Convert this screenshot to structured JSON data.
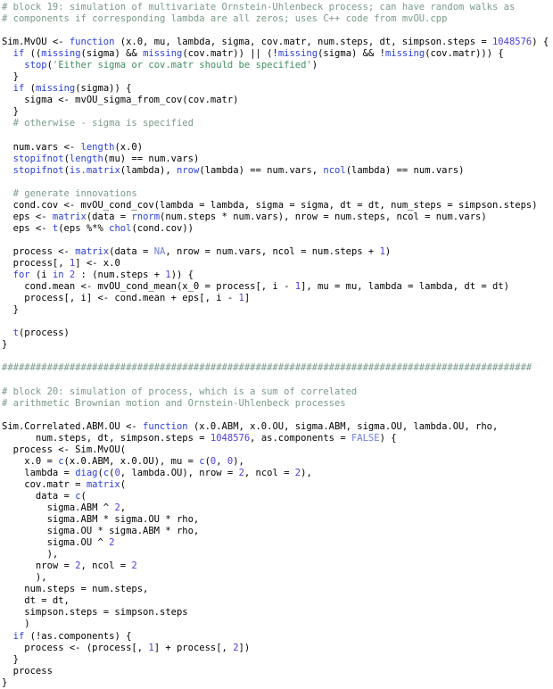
{
  "editor": {
    "language": "R",
    "background": "#ffffff",
    "foreground": "#000000",
    "colors": {
      "comment": "#7a9a8a",
      "keyword": "#2b3fd4",
      "function": "#2b3fd4",
      "number": "#4b3fd6",
      "string": "#3f8f5f",
      "constant": "#6f7fd8",
      "plain": "#000000"
    }
  },
  "code": {
    "lines": [
      [
        {
          "t": "# block 19: simulation of multivariate Ornstein-Uhlenbeck process; can have random walks as",
          "c": "cmt"
        }
      ],
      [
        {
          "t": "# components if corresponding lambda are all zeros; uses C++ code from mvOU.cpp",
          "c": "cmt"
        }
      ],
      [],
      [
        {
          "t": "Sim.MvOU <- ",
          "c": "pl"
        },
        {
          "t": "function",
          "c": "kw"
        },
        {
          "t": " (x.0, mu, lambda, sigma, cov.matr, num.steps, dt, simpson.steps = ",
          "c": "pl"
        },
        {
          "t": "1048576",
          "c": "num"
        },
        {
          "t": ") {",
          "c": "pl"
        }
      ],
      [
        {
          "t": "  ",
          "c": "pl"
        },
        {
          "t": "if",
          "c": "kw"
        },
        {
          "t": " ((",
          "c": "pl"
        },
        {
          "t": "missing",
          "c": "fn"
        },
        {
          "t": "(sigma) && ",
          "c": "pl"
        },
        {
          "t": "missing",
          "c": "fn"
        },
        {
          "t": "(cov.matr)) || (!",
          "c": "pl"
        },
        {
          "t": "missing",
          "c": "fn"
        },
        {
          "t": "(sigma) && !",
          "c": "pl"
        },
        {
          "t": "missing",
          "c": "fn"
        },
        {
          "t": "(cov.matr))) {",
          "c": "pl"
        }
      ],
      [
        {
          "t": "    ",
          "c": "pl"
        },
        {
          "t": "stop",
          "c": "fn"
        },
        {
          "t": "(",
          "c": "pl"
        },
        {
          "t": "'Either sigma or cov.matr should be specified'",
          "c": "str"
        },
        {
          "t": ")",
          "c": "pl"
        }
      ],
      [
        {
          "t": "  }",
          "c": "pl"
        }
      ],
      [
        {
          "t": "  ",
          "c": "pl"
        },
        {
          "t": "if",
          "c": "kw"
        },
        {
          "t": " (",
          "c": "pl"
        },
        {
          "t": "missing",
          "c": "fn"
        },
        {
          "t": "(sigma)) {",
          "c": "pl"
        }
      ],
      [
        {
          "t": "    sigma <- mvOU_sigma_from_cov(cov.matr)",
          "c": "pl"
        }
      ],
      [
        {
          "t": "  }",
          "c": "pl"
        }
      ],
      [
        {
          "t": "  # otherwise - sigma is specified",
          "c": "cmt"
        }
      ],
      [],
      [
        {
          "t": "  num.vars <- ",
          "c": "pl"
        },
        {
          "t": "length",
          "c": "fn"
        },
        {
          "t": "(x.0)",
          "c": "pl"
        }
      ],
      [
        {
          "t": "  ",
          "c": "pl"
        },
        {
          "t": "stopifnot",
          "c": "fn"
        },
        {
          "t": "(",
          "c": "pl"
        },
        {
          "t": "length",
          "c": "fn"
        },
        {
          "t": "(mu) == num.vars)",
          "c": "pl"
        }
      ],
      [
        {
          "t": "  ",
          "c": "pl"
        },
        {
          "t": "stopifnot",
          "c": "fn"
        },
        {
          "t": "(",
          "c": "pl"
        },
        {
          "t": "is.matrix",
          "c": "fn"
        },
        {
          "t": "(lambda), ",
          "c": "pl"
        },
        {
          "t": "nrow",
          "c": "fn"
        },
        {
          "t": "(lambda) == num.vars, ",
          "c": "pl"
        },
        {
          "t": "ncol",
          "c": "fn"
        },
        {
          "t": "(lambda) == num.vars)",
          "c": "pl"
        }
      ],
      [],
      [
        {
          "t": "  # generate innovations",
          "c": "cmt"
        }
      ],
      [
        {
          "t": "  cond.cov <- mvOU_cond_cov(lambda = lambda, sigma = sigma, dt = dt, num_steps = simpson.steps)",
          "c": "pl"
        }
      ],
      [
        {
          "t": "  eps <- ",
          "c": "pl"
        },
        {
          "t": "matrix",
          "c": "fn"
        },
        {
          "t": "(data = ",
          "c": "pl"
        },
        {
          "t": "rnorm",
          "c": "fn"
        },
        {
          "t": "(num.steps * num.vars), nrow = num.steps, ncol = num.vars)",
          "c": "pl"
        }
      ],
      [
        {
          "t": "  eps <- ",
          "c": "pl"
        },
        {
          "t": "t",
          "c": "fn"
        },
        {
          "t": "(eps ",
          "c": "pl"
        },
        {
          "t": "%*%",
          "c": "op"
        },
        {
          "t": " ",
          "c": "pl"
        },
        {
          "t": "chol",
          "c": "fn"
        },
        {
          "t": "(cond.cov))",
          "c": "pl"
        }
      ],
      [],
      [
        {
          "t": "  process <- ",
          "c": "pl"
        },
        {
          "t": "matrix",
          "c": "fn"
        },
        {
          "t": "(data = ",
          "c": "pl"
        },
        {
          "t": "NA",
          "c": "cst"
        },
        {
          "t": ", nrow = num.vars, ncol = num.steps + ",
          "c": "pl"
        },
        {
          "t": "1",
          "c": "num"
        },
        {
          "t": ")",
          "c": "pl"
        }
      ],
      [
        {
          "t": "  process[, ",
          "c": "pl"
        },
        {
          "t": "1",
          "c": "num"
        },
        {
          "t": "] <- x.0",
          "c": "pl"
        }
      ],
      [
        {
          "t": "  ",
          "c": "pl"
        },
        {
          "t": "for",
          "c": "kw"
        },
        {
          "t": " (i ",
          "c": "pl"
        },
        {
          "t": "in",
          "c": "kw"
        },
        {
          "t": " ",
          "c": "pl"
        },
        {
          "t": "2",
          "c": "num"
        },
        {
          "t": " : (num.steps + ",
          "c": "pl"
        },
        {
          "t": "1",
          "c": "num"
        },
        {
          "t": ")) {",
          "c": "pl"
        }
      ],
      [
        {
          "t": "    cond.mean <- mvOU_cond_mean(x_0 = process[, i - ",
          "c": "pl"
        },
        {
          "t": "1",
          "c": "num"
        },
        {
          "t": "], mu = mu, lambda = lambda, dt = dt)",
          "c": "pl"
        }
      ],
      [
        {
          "t": "    process[, i] <- cond.mean + eps[, i - ",
          "c": "pl"
        },
        {
          "t": "1",
          "c": "num"
        },
        {
          "t": "]",
          "c": "pl"
        }
      ],
      [
        {
          "t": "  }",
          "c": "pl"
        }
      ],
      [],
      [
        {
          "t": "  ",
          "c": "pl"
        },
        {
          "t": "t",
          "c": "fn"
        },
        {
          "t": "(process)",
          "c": "pl"
        }
      ],
      [
        {
          "t": "}",
          "c": "pl"
        }
      ],
      [],
      [
        {
          "t": "##############################################################################################",
          "c": "cmt"
        }
      ],
      [],
      [
        {
          "t": "# block 20: simulation of process, which is a sum of correlated",
          "c": "cmt"
        }
      ],
      [
        {
          "t": "# arithmetic Brownian motion and Ornstein-Uhlenbeck processes",
          "c": "cmt"
        }
      ],
      [],
      [
        {
          "t": "Sim.Correlated.ABM.OU <- ",
          "c": "pl"
        },
        {
          "t": "function",
          "c": "kw"
        },
        {
          "t": " (x.0.ABM, x.0.OU, sigma.ABM, sigma.OU, lambda.OU, rho,",
          "c": "pl"
        }
      ],
      [
        {
          "t": "      num.steps, dt, simpson.steps = ",
          "c": "pl"
        },
        {
          "t": "1048576",
          "c": "num"
        },
        {
          "t": ", as.components = ",
          "c": "pl"
        },
        {
          "t": "FALSE",
          "c": "cst"
        },
        {
          "t": ") {",
          "c": "pl"
        }
      ],
      [
        {
          "t": "  process <- Sim.MvOU(",
          "c": "pl"
        }
      ],
      [
        {
          "t": "    x.0 = ",
          "c": "pl"
        },
        {
          "t": "c",
          "c": "fn"
        },
        {
          "t": "(x.0.ABM, x.0.OU), mu = ",
          "c": "pl"
        },
        {
          "t": "c",
          "c": "fn"
        },
        {
          "t": "(",
          "c": "pl"
        },
        {
          "t": "0",
          "c": "num"
        },
        {
          "t": ", ",
          "c": "pl"
        },
        {
          "t": "0",
          "c": "num"
        },
        {
          "t": "),",
          "c": "pl"
        }
      ],
      [
        {
          "t": "    lambda = ",
          "c": "pl"
        },
        {
          "t": "diag",
          "c": "fn"
        },
        {
          "t": "(",
          "c": "pl"
        },
        {
          "t": "c",
          "c": "fn"
        },
        {
          "t": "(",
          "c": "pl"
        },
        {
          "t": "0",
          "c": "num"
        },
        {
          "t": ", lambda.OU), nrow = ",
          "c": "pl"
        },
        {
          "t": "2",
          "c": "num"
        },
        {
          "t": ", ncol = ",
          "c": "pl"
        },
        {
          "t": "2",
          "c": "num"
        },
        {
          "t": "),",
          "c": "pl"
        }
      ],
      [
        {
          "t": "    cov.matr = ",
          "c": "pl"
        },
        {
          "t": "matrix",
          "c": "fn"
        },
        {
          "t": "(",
          "c": "pl"
        }
      ],
      [
        {
          "t": "      data = ",
          "c": "pl"
        },
        {
          "t": "c",
          "c": "fn"
        },
        {
          "t": "(",
          "c": "pl"
        }
      ],
      [
        {
          "t": "        sigma.ABM ^ ",
          "c": "pl"
        },
        {
          "t": "2",
          "c": "num"
        },
        {
          "t": ",",
          "c": "pl"
        }
      ],
      [
        {
          "t": "        sigma.ABM * sigma.OU * rho,",
          "c": "pl"
        }
      ],
      [
        {
          "t": "        sigma.OU * sigma.ABM * rho,",
          "c": "pl"
        }
      ],
      [
        {
          "t": "        sigma.OU ^ ",
          "c": "pl"
        },
        {
          "t": "2",
          "c": "num"
        }
      ],
      [
        {
          "t": "        ),",
          "c": "pl"
        }
      ],
      [
        {
          "t": "      nrow = ",
          "c": "pl"
        },
        {
          "t": "2",
          "c": "num"
        },
        {
          "t": ", ncol = ",
          "c": "pl"
        },
        {
          "t": "2",
          "c": "num"
        }
      ],
      [
        {
          "t": "      ),",
          "c": "pl"
        }
      ],
      [
        {
          "t": "    num.steps = num.steps,",
          "c": "pl"
        }
      ],
      [
        {
          "t": "    dt = dt,",
          "c": "pl"
        }
      ],
      [
        {
          "t": "    simpson.steps = simpson.steps",
          "c": "pl"
        }
      ],
      [
        {
          "t": "    )",
          "c": "pl"
        }
      ],
      [
        {
          "t": "  ",
          "c": "pl"
        },
        {
          "t": "if",
          "c": "kw"
        },
        {
          "t": " (!as.components) {",
          "c": "pl"
        }
      ],
      [
        {
          "t": "    process <- (process[, ",
          "c": "pl"
        },
        {
          "t": "1",
          "c": "num"
        },
        {
          "t": "] + process[, ",
          "c": "pl"
        },
        {
          "t": "2",
          "c": "num"
        },
        {
          "t": "])",
          "c": "pl"
        }
      ],
      [
        {
          "t": "  }",
          "c": "pl"
        }
      ],
      [
        {
          "t": "  process",
          "c": "pl"
        }
      ],
      [
        {
          "t": "}",
          "c": "pl"
        }
      ]
    ]
  }
}
